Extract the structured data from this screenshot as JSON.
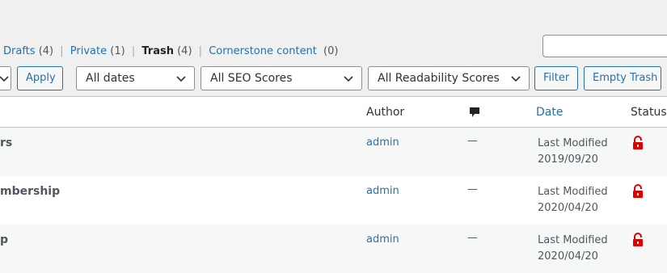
{
  "subsubsub": {
    "drafts": {
      "label": "Drafts",
      "count": "(4)"
    },
    "private": {
      "label": "Private",
      "count": "(1)"
    },
    "trash": {
      "label": "Trash",
      "count": "(4)"
    },
    "cornerstone": {
      "label": "Cornerstone content",
      "count": "(0)"
    },
    "separator": "|"
  },
  "search": {
    "value": "",
    "placeholder": ""
  },
  "toolbar": {
    "apply_label": "Apply",
    "dates_select": "All dates",
    "seo_select": "All SEO Scores",
    "readability_select": "All Readability Scores",
    "filter_label": "Filter",
    "empty_trash_label": "Empty Trash"
  },
  "columns": {
    "author": "Author",
    "comments_icon": "comment-bubble-icon",
    "date": "Date",
    "status": "Status"
  },
  "rows": [
    {
      "title": "rs",
      "author": "admin",
      "comments": "—",
      "date_label": "Last Modified",
      "date": "2019/09/20",
      "status_icon": "unlocked-padlock-icon"
    },
    {
      "title": "mbership",
      "author": "admin",
      "comments": "—",
      "date_label": "Last Modified",
      "date": "2020/04/20",
      "status_icon": "unlocked-padlock-icon"
    },
    {
      "title": "p",
      "author": "admin",
      "comments": "—",
      "date_label": "Last Modified",
      "date": "2020/04/20",
      "status_icon": "unlocked-padlock-icon"
    }
  ],
  "colors": {
    "link": "#2271b1",
    "lock": "#e00000",
    "alt_row": "#f6f7f7"
  }
}
